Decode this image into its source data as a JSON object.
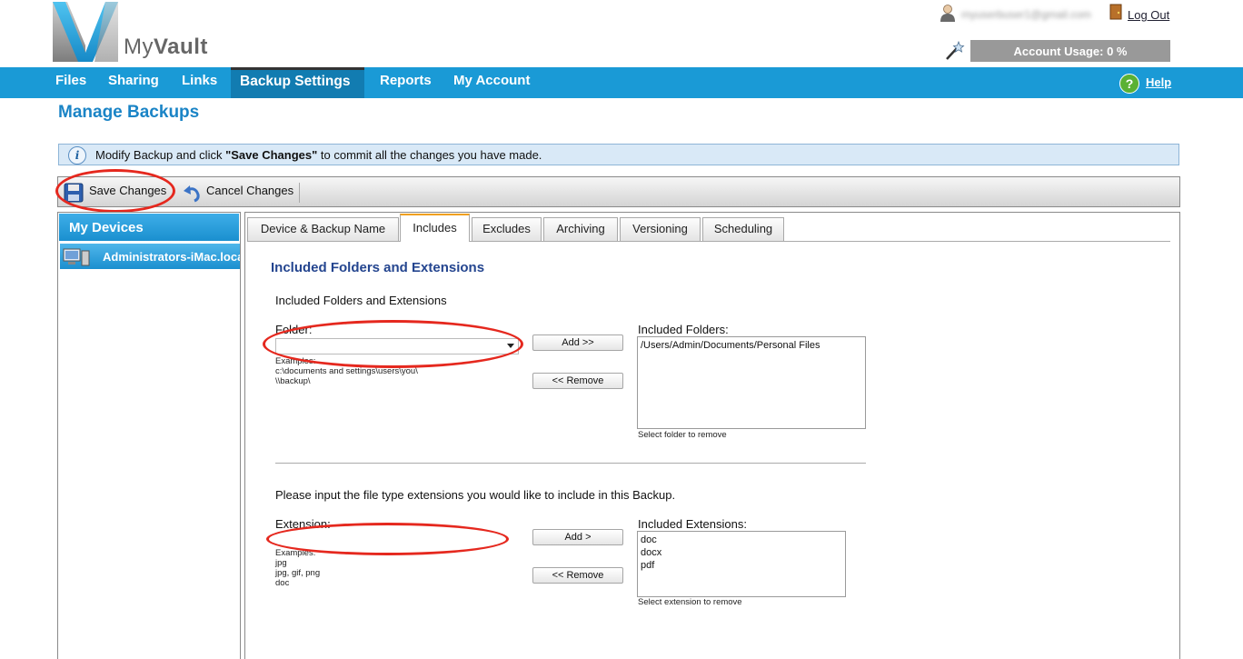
{
  "brand": {
    "logo_prefix": "My",
    "logo_bold": "Vault"
  },
  "header": {
    "user_email": "myuserbuser1@gmail.com",
    "logout": "Log Out",
    "account_usage": "Account Usage: 0 %"
  },
  "nav": {
    "items": [
      "Files",
      "Sharing",
      "Links",
      "Backup Settings",
      "Reports",
      "My Account"
    ],
    "active": "Backup Settings",
    "help": "Help"
  },
  "page_title": "Manage Backups",
  "info": {
    "prefix": "Modify Backup and click ",
    "bold": "\"Save Changes\"",
    "suffix": " to commit all the changes you have made."
  },
  "toolbar": {
    "save": "Save Changes",
    "cancel": "Cancel Changes"
  },
  "sidebar": {
    "title": "My Devices",
    "devices": [
      "Administrators-iMac.local"
    ]
  },
  "tabs": [
    "Device & Backup Name",
    "Includes",
    "Excludes",
    "Archiving",
    "Versioning",
    "Scheduling"
  ],
  "active_tab": "Includes",
  "includes": {
    "section_title": "Included Folders and Extensions",
    "subtitle": "Included Folders and Extensions",
    "folder": {
      "label": "Folder:",
      "value": "",
      "examples_label": "Examples:",
      "examples": [
        "c:\\documents and settings\\users\\you\\",
        "\\\\backup\\"
      ],
      "add_button": "Add >>",
      "remove_button": "<< Remove",
      "list_label": "Included Folders:",
      "list": [
        "/Users/Admin/Documents/Personal Files"
      ],
      "hint": "Select folder to remove"
    },
    "extension": {
      "prompt": "Please input the file type extensions you would like to include in this Backup.",
      "label": "Extension:",
      "value": "",
      "examples_label": "Examples:",
      "examples": [
        "jpg",
        "jpg, gif, png",
        "doc"
      ],
      "add_button": "Add >",
      "remove_button": "<< Remove",
      "list_label": "Included Extensions:",
      "list": [
        "doc",
        "docx",
        "pdf"
      ],
      "hint": "Select extension to remove"
    }
  },
  "colors": {
    "nav": "#1a9ad6",
    "title": "#1a84c6",
    "section_title": "#24458f",
    "annotation": "#e5281e"
  }
}
